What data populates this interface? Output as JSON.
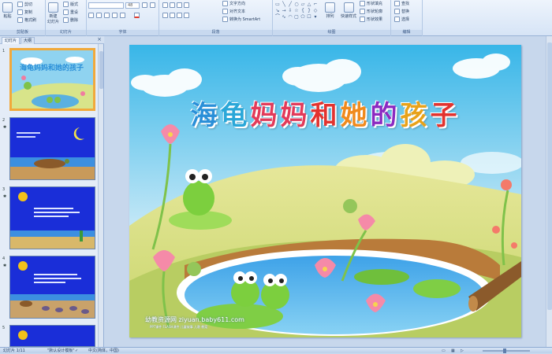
{
  "ribbon": {
    "clipboard": {
      "paste": "粘贴",
      "cut": "剪切",
      "copy": "复制",
      "format_painter": "格式刷",
      "group_label": "剪贴板"
    },
    "slides": {
      "new_slide": "新建",
      "new_slide_sub": "幻灯片",
      "layout": "版式",
      "reset": "重设",
      "delete": "删除",
      "group_label": "幻灯片"
    },
    "font": {
      "font_size": "48",
      "group_label": "字体"
    },
    "paragraph": {
      "text_direction": "文字方向",
      "align_text": "对齐文本",
      "convert_smartart": "转换为 SmartArt",
      "group_label": "段落"
    },
    "drawing": {
      "arrange": "排列",
      "quick_styles": "快速样式",
      "shape_fill": "形状填充",
      "shape_outline": "形状轮廓",
      "shape_effects": "形状效果",
      "group_label": "绘图"
    },
    "editing": {
      "find": "查找",
      "replace": "替换",
      "select": "选择",
      "group_label": "编辑"
    }
  },
  "panel": {
    "tab_slides": "幻灯片",
    "tab_outline": "大纲",
    "close": "×",
    "thumbnails": [
      {
        "number": "1",
        "selected": true
      },
      {
        "number": "2",
        "selected": false
      },
      {
        "number": "3",
        "selected": false
      },
      {
        "number": "4",
        "selected": false
      },
      {
        "number": "5",
        "selected": false
      }
    ]
  },
  "slide": {
    "title_chars": [
      {
        "ch": "海",
        "color": "#2a8fd8"
      },
      {
        "ch": "龟",
        "color": "#2aa7d8"
      },
      {
        "ch": "妈",
        "color": "#e23b5a"
      },
      {
        "ch": "妈",
        "color": "#e23b5a"
      },
      {
        "ch": "和",
        "color": "#e2332f"
      },
      {
        "ch": "她",
        "color": "#f08a1d"
      },
      {
        "ch": "的",
        "color": "#8b2ac1"
      },
      {
        "ch": "孩",
        "color": "#e8a21a"
      },
      {
        "ch": "子",
        "color": "#e2332f"
      }
    ],
    "watermark": "幼教资源网 ziyuan.baby611.com",
    "watermark_small": "PPT课件 FLASH课件 儿童故事 儿歌 教案"
  },
  "status": {
    "slide_counter": "幻灯片 1/11",
    "theme": "\"默认设计模板\"",
    "language": "中文(简体，中国)"
  },
  "colors": {
    "accent": "#f1a93b",
    "ribbon": "#d6e4f6"
  }
}
